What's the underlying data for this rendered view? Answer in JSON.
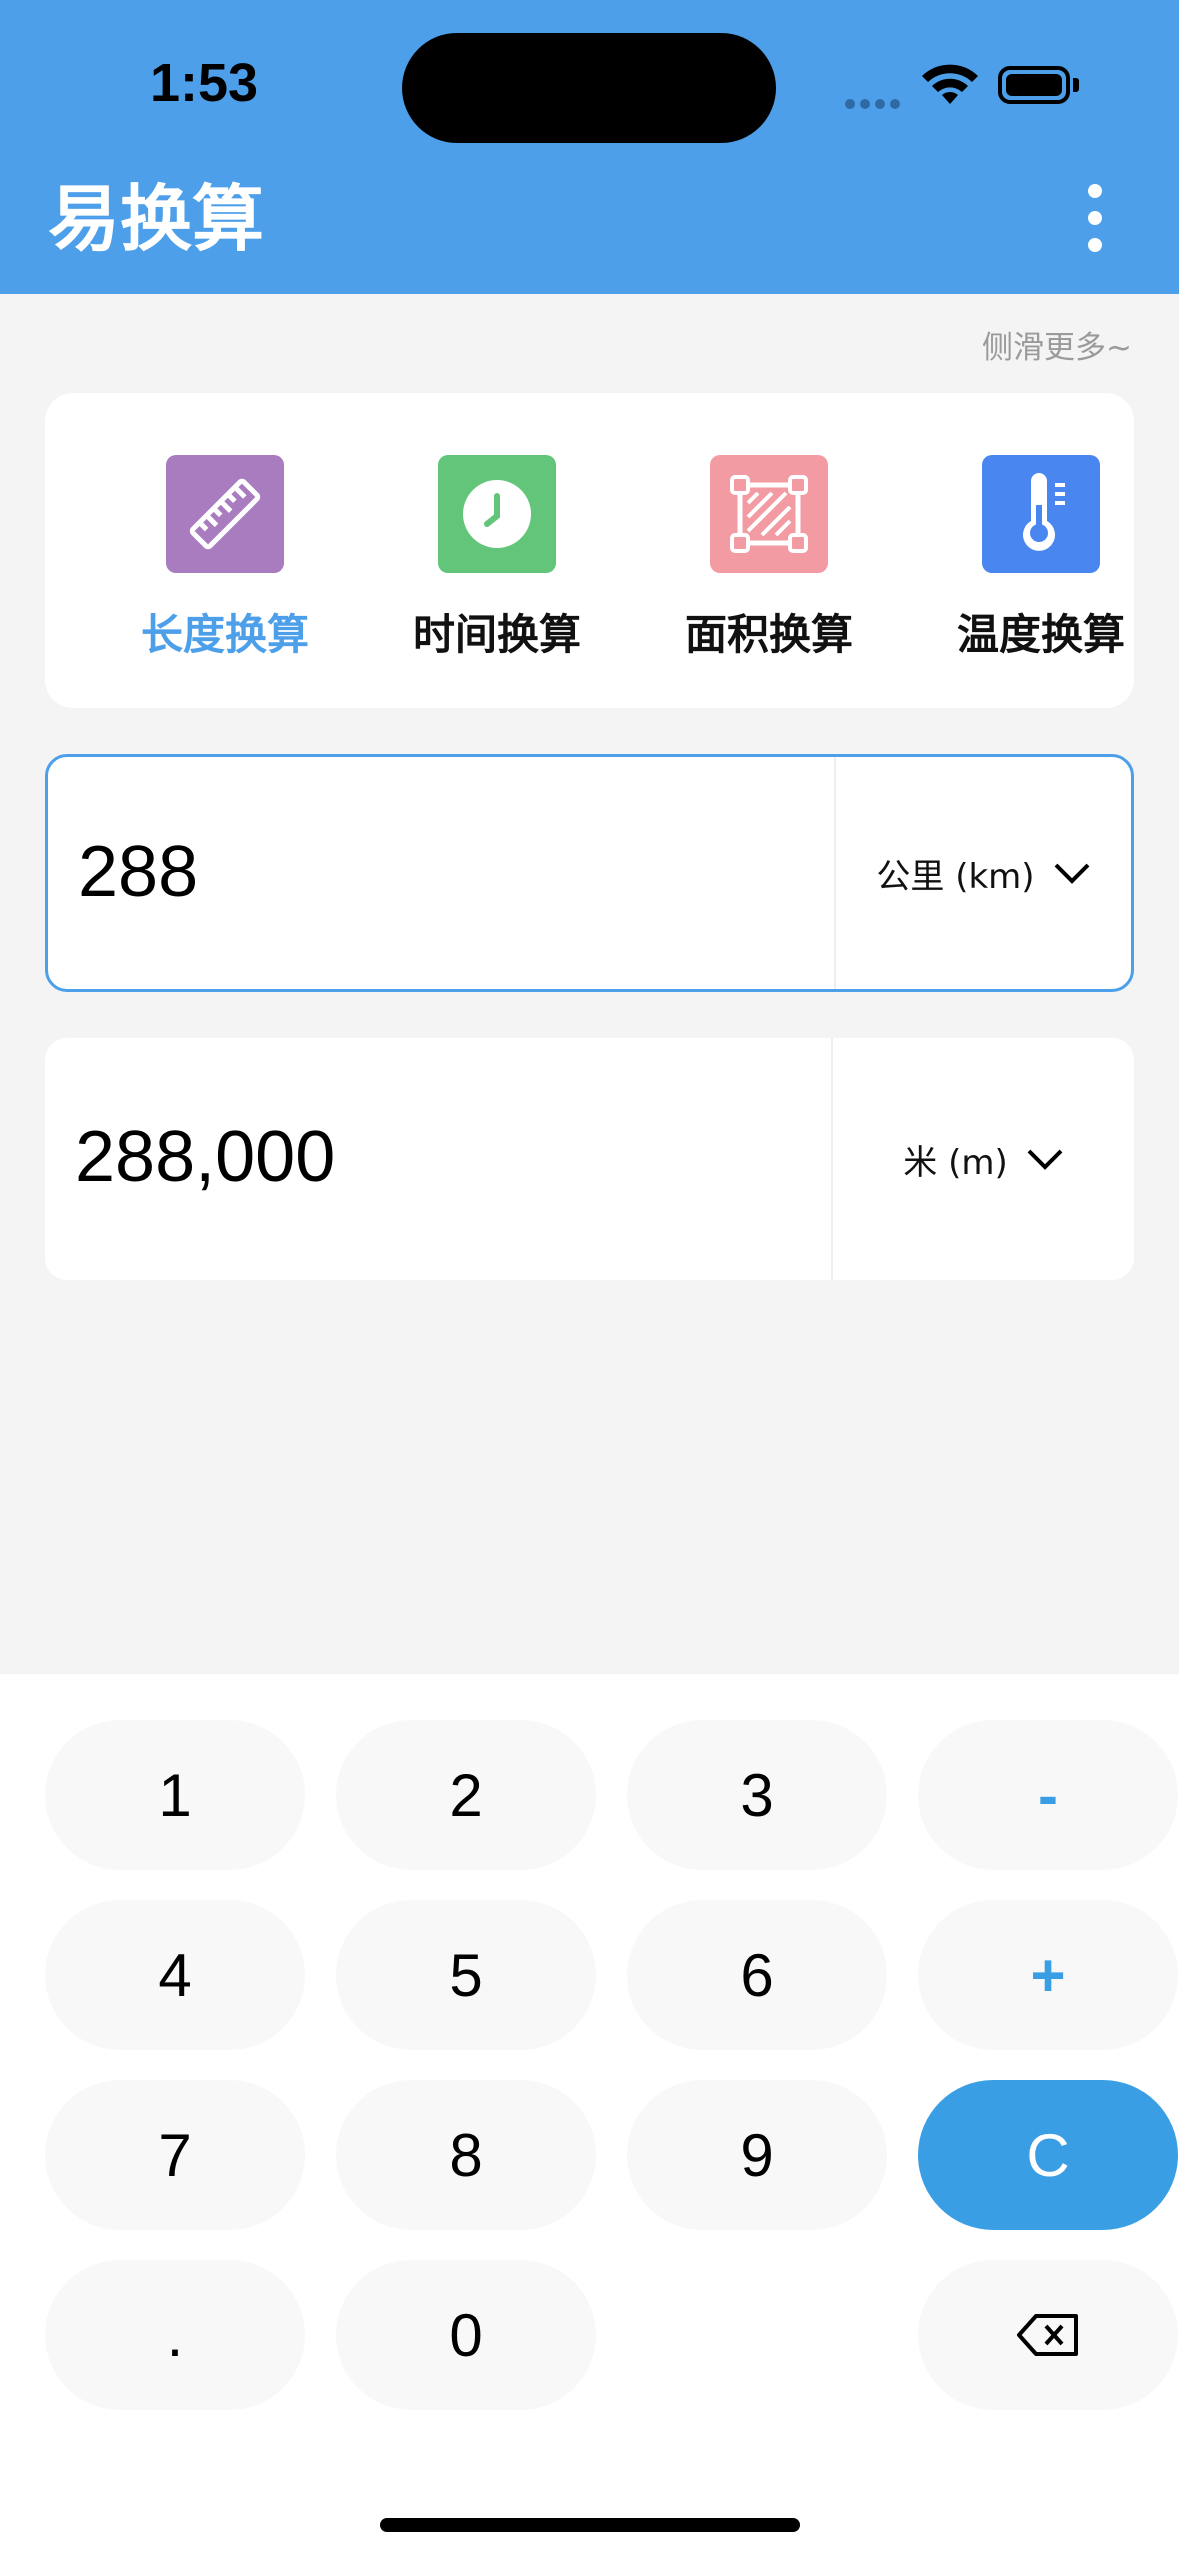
{
  "status_bar": {
    "time": "1:53"
  },
  "app": {
    "title": "易换算",
    "scroll_hint": "侧滑更多~"
  },
  "categories": [
    {
      "label": "长度换算",
      "icon": "ruler-icon",
      "color": "#a97bbf",
      "active": true
    },
    {
      "label": "时间换算",
      "icon": "clock-icon",
      "color": "#62c57a",
      "active": false
    },
    {
      "label": "面积换算",
      "icon": "area-icon",
      "color": "#f29ba3",
      "active": false
    },
    {
      "label": "温度换算",
      "icon": "thermometer-icon",
      "color": "#4a86f0",
      "active": false
    }
  ],
  "input": {
    "value": "288",
    "unit": "公里 (km)"
  },
  "output": {
    "value": "288,000",
    "unit": "米 (m)"
  },
  "keypad": {
    "k1": "1",
    "k2": "2",
    "k3": "3",
    "minus": "-",
    "k4": "4",
    "k5": "5",
    "k6": "6",
    "plus": "+",
    "k7": "7",
    "k8": "8",
    "k9": "9",
    "clear": "C",
    "dot": ".",
    "k0": "0"
  },
  "colors": {
    "header": "#4c9fe8",
    "accent": "#3a9ee4"
  }
}
